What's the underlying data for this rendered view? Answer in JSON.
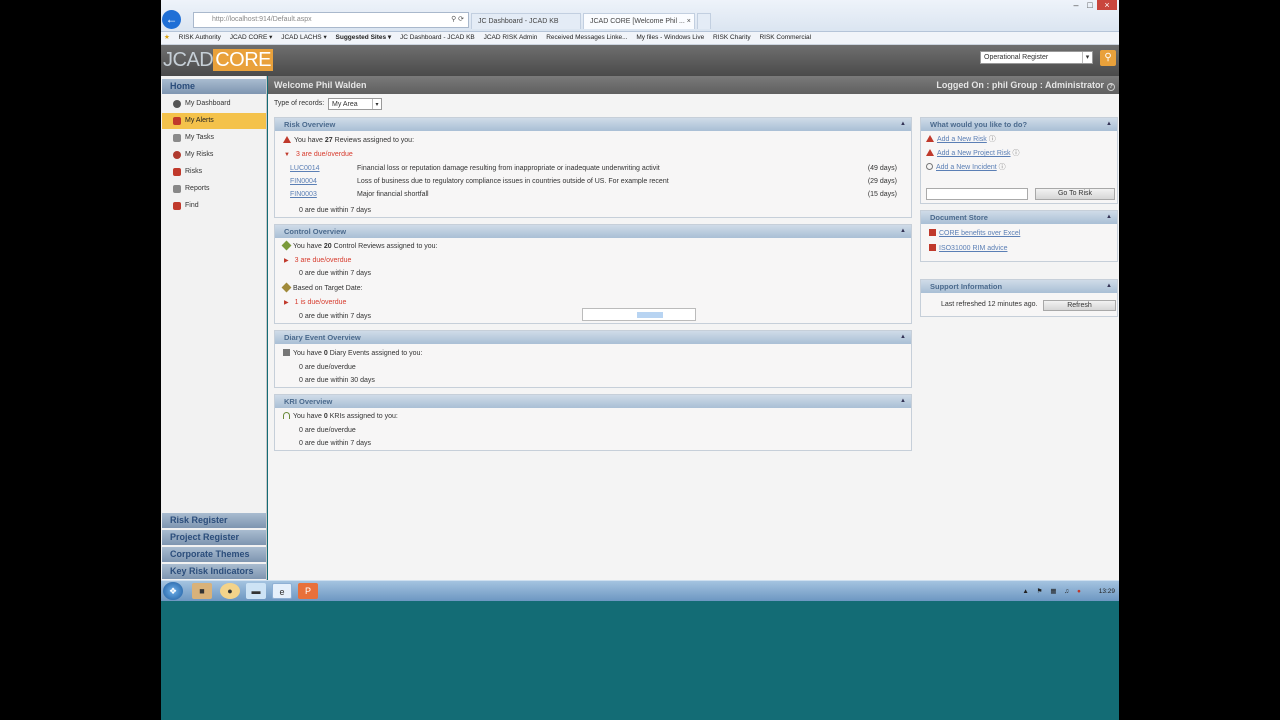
{
  "browser": {
    "address": "http://localhost:914/Default.aspx",
    "tabs": [
      {
        "label": "JC Dashboard - JCAD KB"
      },
      {
        "label": "JCAD CORE [Welcome Phil ..."
      }
    ],
    "favorites": [
      {
        "label": "RISK Authority"
      },
      {
        "label": "JCAD CORE ▾"
      },
      {
        "label": "JCAD LACHS ▾"
      },
      {
        "label": "Suggested Sites ▾"
      },
      {
        "label": "JC Dashboard - JCAD KB"
      },
      {
        "label": "JCAD RISK Admin"
      },
      {
        "label": "Received Messages Linke..."
      },
      {
        "label": "My files - Windows Live"
      },
      {
        "label": "RISK Charity"
      },
      {
        "label": "RISK Commercial"
      }
    ]
  },
  "header": {
    "logo_left": "JCAD",
    "logo_right": "CORE",
    "register_select": "Operational Register"
  },
  "sidebar": {
    "home": "Home",
    "items": [
      {
        "label": "My Dashboard",
        "color": "#555555"
      },
      {
        "label": "My Alerts",
        "color": "#c0392b",
        "active": true
      },
      {
        "label": "My Tasks",
        "color": "#7d7d7d"
      },
      {
        "label": "My Risks",
        "color": "#b03a2e"
      },
      {
        "label": "Risks",
        "color": "#c0392b"
      },
      {
        "label": "Reports",
        "color": "#777777"
      },
      {
        "label": "Find",
        "color": "#c0392b"
      }
    ],
    "sections": [
      {
        "label": "Risk Register"
      },
      {
        "label": "Project Register"
      },
      {
        "label": "Corporate Themes"
      },
      {
        "label": "Key Risk Indicators"
      }
    ]
  },
  "main": {
    "welcome": "Welcome Phil Walden",
    "logged_on": "Logged On : phil Group : Administrator",
    "records_label": "Type of records:",
    "records_value": "My Area",
    "risk_overview": {
      "title": "Risk Overview",
      "summary_pre": "You have ",
      "summary_count": "27",
      "summary_post": " Reviews assigned to you:",
      "overdue": "3 are due/overdue",
      "rows": [
        {
          "id": "LUC0014",
          "desc": "Financial loss or reputation damage resulting from inappropriate or inadequate underwriting activit",
          "days": "(49 days)"
        },
        {
          "id": "FIN0004",
          "desc": "Loss of business due to regulatory compliance issues in countries outside of US. For example recent",
          "days": "(29 days)"
        },
        {
          "id": "FIN0003",
          "desc": "Major financial shortfall",
          "days": "(15 days)"
        }
      ],
      "within": "0 are due within 7 days"
    },
    "control_overview": {
      "title": "Control Overview",
      "summary_pre": "You have ",
      "summary_count": "20",
      "summary_post": " Control Reviews assigned to you:",
      "overdue": "3 are due/overdue",
      "within": "0 are due within 7 days",
      "target_label": "Based on Target Date:",
      "target_overdue": "1 is due/overdue",
      "target_within": "0 are due within 7 days"
    },
    "diary_overview": {
      "title": "Diary Event Overview",
      "summary_pre": "You have ",
      "summary_count": "0",
      "summary_post": " Diary Events assigned to you:",
      "overdue": "0 are due/overdue",
      "within": "0 are due within 30 days"
    },
    "kri_overview": {
      "title": "KRI Overview",
      "summary_pre": "You have ",
      "summary_count": "0",
      "summary_post": " KRIs assigned to you:",
      "overdue": "0 are due/overdue",
      "within": "0 are due within 7 days"
    },
    "loading_progress": 0.5
  },
  "right": {
    "actions_title": "What would you like to do?",
    "actions": [
      {
        "label": "Add a New Risk"
      },
      {
        "label": "Add a New Project Risk"
      },
      {
        "label": "Add a New Incident"
      }
    ],
    "goto_placeholder": "",
    "goto_button": "Go To Risk",
    "docs_title": "Document Store",
    "docs": [
      {
        "label": "CORE benefits over Excel"
      },
      {
        "label": "ISO31000 RIM advice"
      }
    ],
    "support_title": "Support Information",
    "last_refreshed": "Last refreshed 12 minutes ago.",
    "refresh_button": "Refresh"
  },
  "taskbar": {
    "time": "13:29"
  },
  "colors": {
    "accent": "#e9a13b",
    "overdue": "#d73b2d",
    "link": "#5b7fb5",
    "desktop": "#136c75"
  }
}
